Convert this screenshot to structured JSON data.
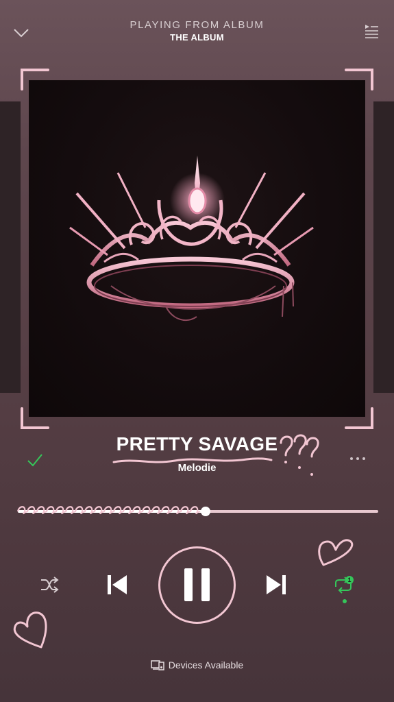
{
  "header": {
    "context_label": "PLAYING FROM ALBUM",
    "album_name": "THE ALBUM",
    "collapse_icon": "chevron-down-icon",
    "queue_icon": "queue-icon"
  },
  "track": {
    "title": "PRETTY SAVAGE",
    "artist": "Melodie",
    "liked": true,
    "progress": 0.52
  },
  "controls": {
    "shuffle_icon": "shuffle-icon",
    "previous_icon": "skip-back-icon",
    "pause_icon": "pause-icon",
    "next_icon": "skip-forward-icon",
    "repeat_icon": "repeat-one-icon",
    "repeat_badge": "1"
  },
  "footer": {
    "devices_label": "Devices Available",
    "devices_icon": "devices-icon"
  },
  "colors": {
    "background": "#5e464d",
    "accent_pink": "#f2c6d2",
    "active_green": "#35c65a",
    "text": "#ffffff"
  }
}
